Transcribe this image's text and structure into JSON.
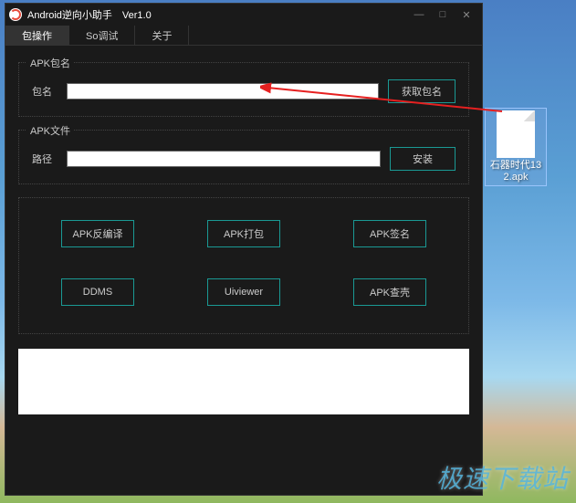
{
  "window": {
    "title": "Android逆向小助手　Ver1.0"
  },
  "tabs": {
    "t0": "包操作",
    "t1": "So调试",
    "t2": "关于"
  },
  "section1": {
    "legend": "APK包名",
    "label": "包名",
    "value": "",
    "button": "获取包名"
  },
  "section2": {
    "legend": "APK文件",
    "label": "路径",
    "value": "",
    "button": "安装"
  },
  "actions": {
    "a0": "APK反编译",
    "a1": "APK打包",
    "a2": "APK签名",
    "a3": "DDMS",
    "a4": "Uiviewer",
    "a5": "APK查壳"
  },
  "desktop": {
    "filename": "石器时代132.apk"
  },
  "watermark": "极速下载站"
}
